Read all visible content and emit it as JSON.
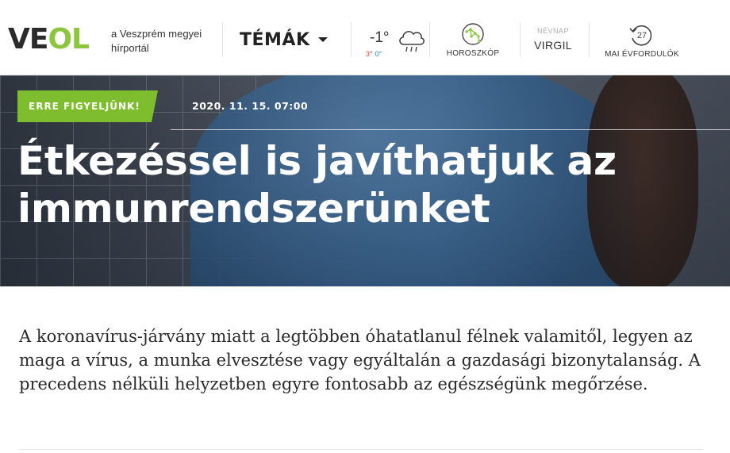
{
  "brand": {
    "logo_left": "VE",
    "logo_right": "OL",
    "tagline_line1": "a Veszprém megyei",
    "tagline_line2": "hírportál",
    "accent_color": "#8cc63f"
  },
  "nav": {
    "temak_label": "TÉMÁK"
  },
  "weather": {
    "temp": "-1°",
    "max": "3°",
    "min": "0°",
    "icon": "cloud-rain-icon"
  },
  "horoscope": {
    "label": "HOROSZKÓP",
    "icon": "constellation-icon"
  },
  "nameday": {
    "caption": "NÉVNAP",
    "name": "VIRGIL"
  },
  "anniversaries": {
    "count": "27",
    "label": "MAI ÉVFORDULÓK",
    "icon": "history-clock-icon"
  },
  "article": {
    "badge": "ERRE FIGYELJÜNK!",
    "date": "2020. 11. 15. 07:00",
    "title_line1": "Étkezéssel is javíthatjuk az",
    "title_line2": "immunrendszerünket",
    "lead": "A koronavírus-járvány miatt a legtöbben óhatatlanul félnek valamitől, legyen az maga a vírus, a munka elvesztése vagy egyáltalán a gazdasági bizonytalanság. A precedens nélküli helyzetben egyre fontosabb az egészségünk megőrzése."
  }
}
